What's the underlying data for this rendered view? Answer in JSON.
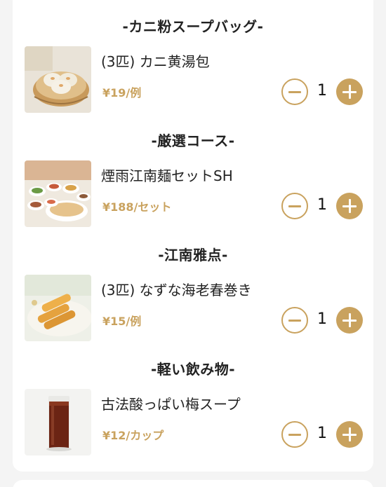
{
  "accent_color": "#c9a25e",
  "sections": [
    {
      "category": "-カニ粉スープバッグ-",
      "item": {
        "name": "(3匹) カニ黄湯包",
        "price": "¥19/例",
        "quantity": "1",
        "image": "soup-dumplings-image"
      }
    },
    {
      "category": "-厳選コース-",
      "item": {
        "name": "煙雨江南麺セットSH",
        "price": "¥188/セット",
        "quantity": "1",
        "image": "noodle-set-image"
      }
    },
    {
      "category": "-江南雅点-",
      "item": {
        "name": "(3匹) なずな海老春巻き",
        "price": "¥15/例",
        "quantity": "1",
        "image": "spring-rolls-image"
      }
    },
    {
      "category": "-軽い飲み物-",
      "item": {
        "name": "古法酸っぱい梅スープ",
        "price": "¥12/カップ",
        "quantity": "1",
        "image": "plum-drink-image"
      }
    }
  ]
}
